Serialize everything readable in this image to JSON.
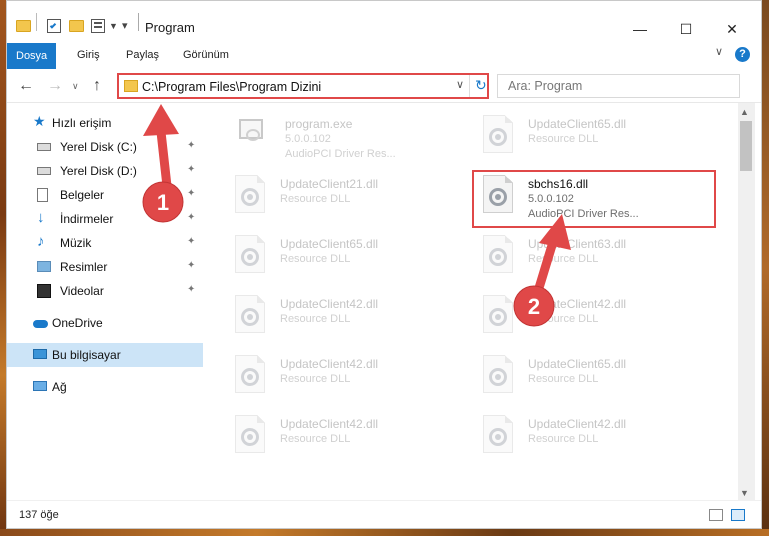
{
  "window": {
    "title": "Program",
    "controls": {
      "minimize": "—",
      "maximize": "☐",
      "close": "✕"
    }
  },
  "ribbon": {
    "tabs": [
      "Dosya",
      "Giriş",
      "Paylaş",
      "Görünüm"
    ],
    "help": "?",
    "expand": "∨"
  },
  "nav": {
    "back": "←",
    "forward": "→",
    "recent": "∨",
    "up": "↑",
    "address": "C:\\Program Files\\Program Dizini",
    "address_chevron": "∨",
    "refresh": "↻",
    "search_placeholder": "Ara: Program"
  },
  "sidebar": {
    "quick_access": "Hızlı erişim",
    "items": [
      {
        "label": "Yerel Disk (C:)",
        "icon": "drive-icon",
        "pinned": true
      },
      {
        "label": "Yerel Disk (D:)",
        "icon": "drive-icon",
        "pinned": true
      },
      {
        "label": "Belgeler",
        "icon": "documents-icon",
        "pinned": true
      },
      {
        "label": "İndirmeler",
        "icon": "download-icon",
        "pinned": true
      },
      {
        "label": "Müzik",
        "icon": "music-icon",
        "pinned": true
      },
      {
        "label": "Resimler",
        "icon": "pictures-icon",
        "pinned": true
      },
      {
        "label": "Videolar",
        "icon": "video-icon",
        "pinned": true
      }
    ],
    "onedrive": "OneDrive",
    "this_pc": "Bu bilgisayar",
    "network": "Ağ",
    "pin_glyph": "📌"
  },
  "files": {
    "col1": [
      {
        "name": "program.exe",
        "line1": "5.0.0.102",
        "line2": "AudioPCI Driver Res..."
      },
      {
        "name": "UpdateClient21.dll",
        "line1": "Resource DLL",
        "line2": ""
      },
      {
        "name": "UpdateClient65.dll",
        "line1": "Resource DLL",
        "line2": ""
      },
      {
        "name": "UpdateClient42.dll",
        "line1": "Resource DLL",
        "line2": ""
      },
      {
        "name": "UpdateClient42.dll",
        "line1": "Resource DLL",
        "line2": ""
      },
      {
        "name": "UpdateClient42.dll",
        "line1": "Resource DLL",
        "line2": ""
      }
    ],
    "col2": [
      {
        "name": "UpdateClient65.dll",
        "line1": "Resource DLL",
        "line2": ""
      },
      {
        "name": "sbchs16.dll",
        "line1": "5.0.0.102",
        "line2": "AudioPCI Driver Res..."
      },
      {
        "name": "UpdateClient63.dll",
        "line1": "Resource DLL",
        "line2": ""
      },
      {
        "name": "UpdateClient42.dll",
        "line1": "Resource DLL",
        "line2": ""
      },
      {
        "name": "UpdateClient65.dll",
        "line1": "Resource DLL",
        "line2": ""
      },
      {
        "name": "UpdateClient42.dll",
        "line1": "Resource DLL",
        "line2": ""
      }
    ]
  },
  "status": {
    "item_count": "137 öğe"
  },
  "callouts": {
    "one": "1",
    "two": "2"
  },
  "colors": {
    "accent": "#1979ca",
    "highlight": "#e04848",
    "callout": "#e04848"
  }
}
